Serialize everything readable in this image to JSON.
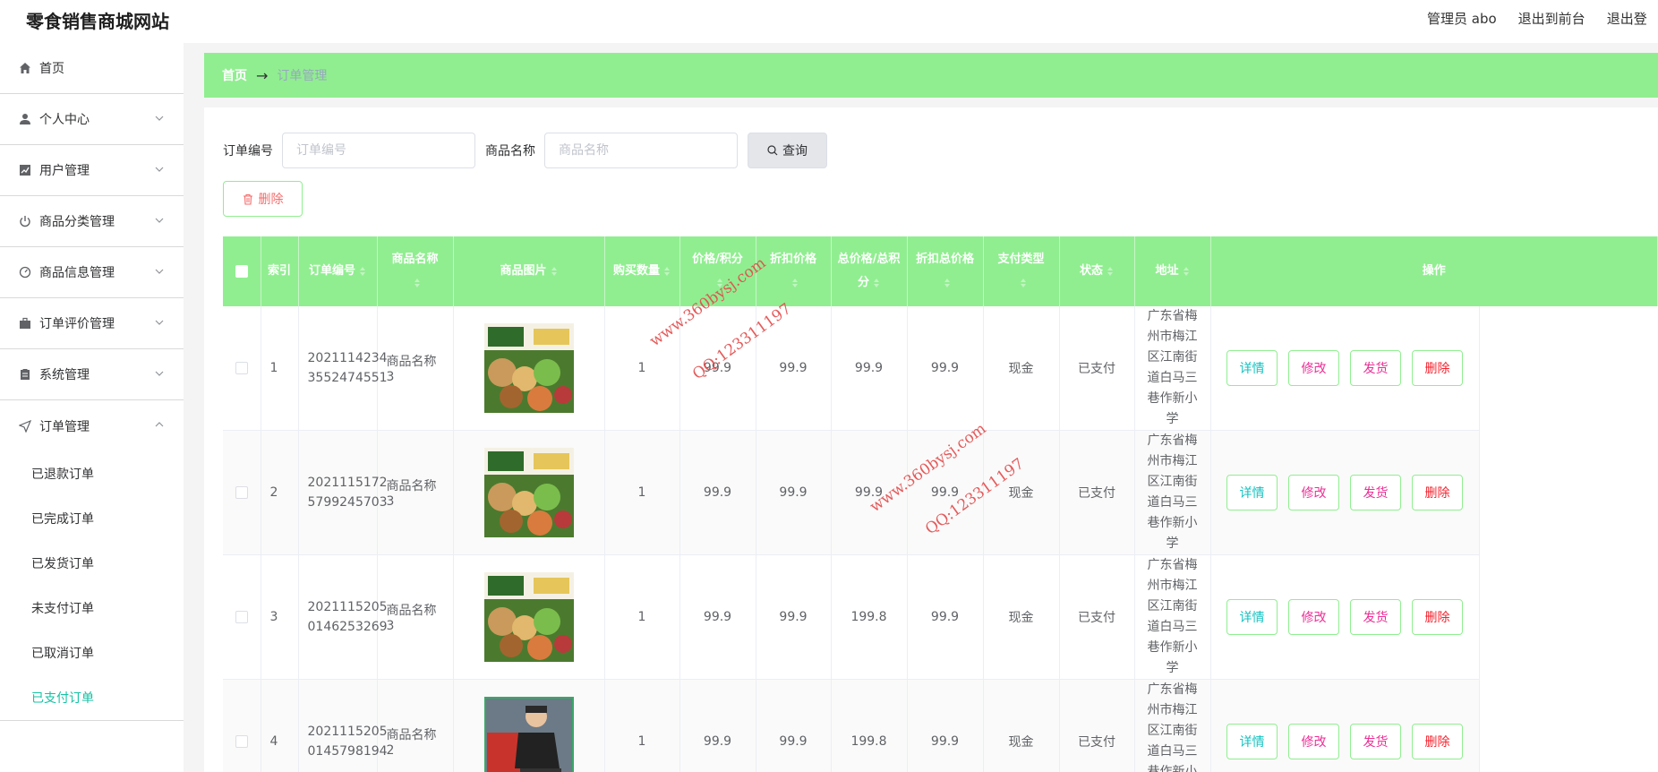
{
  "header": {
    "site_title": "零食销售商城网站",
    "admin_label": "管理员 abo",
    "back_to_front": "退出到前台",
    "logout": "退出登"
  },
  "sidebar": {
    "items": [
      {
        "label": "首页",
        "icon": "home-icon"
      },
      {
        "label": "个人中心",
        "icon": "user-icon"
      },
      {
        "label": "用户管理",
        "icon": "chart-icon"
      },
      {
        "label": "商品分类管理",
        "icon": "power-icon"
      },
      {
        "label": "商品信息管理",
        "icon": "gauge-icon"
      },
      {
        "label": "订单评价管理",
        "icon": "briefcase-icon"
      },
      {
        "label": "系统管理",
        "icon": "clipboard-icon"
      },
      {
        "label": "订单管理",
        "icon": "send-icon"
      }
    ],
    "sub_items": [
      {
        "label": "已退款订单",
        "active": false
      },
      {
        "label": "已完成订单",
        "active": false
      },
      {
        "label": "已发货订单",
        "active": false
      },
      {
        "label": "未支付订单",
        "active": false
      },
      {
        "label": "已取消订单",
        "active": false
      },
      {
        "label": "已支付订单",
        "active": true
      }
    ]
  },
  "breadcrumb": {
    "home": "首页",
    "arrow": "→",
    "current": "订单管理"
  },
  "search": {
    "order_no_label": "订单编号",
    "order_no_placeholder": "订单编号",
    "product_name_label": "商品名称",
    "product_name_placeholder": "商品名称",
    "search_button": "查询"
  },
  "toolbar": {
    "delete_button": "删除"
  },
  "table": {
    "headers": [
      "索引",
      "订单编号",
      "商品名称",
      "商品图片",
      "购买数量",
      "价格/积分",
      "折扣价格",
      "总价格/总积分",
      "折扣总价格",
      "支付类型",
      "状态",
      "地址",
      "操作"
    ],
    "rows": [
      {
        "index": "1",
        "order_no": "20211142343552474551",
        "order_no_l1": "2021114234",
        "order_no_l2": "3552474551",
        "product": "商品名称3",
        "qty": "1",
        "price": "99.9",
        "discount_price": "99.9",
        "total": "99.9",
        "discount_total": "99.9",
        "pay_type": "现金",
        "status": "已支付",
        "address": "广东省梅州市梅江区江南街道白马三巷作新小学",
        "image": "snack-box"
      },
      {
        "index": "2",
        "order_no": "20211151725799245703",
        "order_no_l1": "2021115172",
        "order_no_l2": "5799245703",
        "product": "商品名称3",
        "qty": "1",
        "price": "99.9",
        "discount_price": "99.9",
        "total": "99.9",
        "discount_total": "99.9",
        "pay_type": "现金",
        "status": "已支付",
        "address": "广东省梅州市梅江区江南街道白马三巷作新小学",
        "image": "snack-box"
      },
      {
        "index": "3",
        "order_no": "20211152050146253269",
        "order_no_l1": "2021115205",
        "order_no_l2": "0146253269",
        "product": "商品名称3",
        "qty": "1",
        "price": "99.9",
        "discount_price": "99.9",
        "total": "199.8",
        "discount_total": "99.9",
        "pay_type": "现金",
        "status": "已支付",
        "address": "广东省梅州市梅江区江南街道白马三巷作新小学",
        "image": "snack-box"
      },
      {
        "index": "4",
        "order_no": "20211152050145798194",
        "order_no_l1": "2021115205",
        "order_no_l2": "0145798194",
        "product": "商品名称2",
        "qty": "1",
        "price": "99.9",
        "discount_price": "99.9",
        "total": "199.8",
        "discount_total": "99.9",
        "pay_type": "现金",
        "status": "已支付",
        "address": "广东省梅州市梅江区江南街道白马三巷作新小学",
        "image": "person-photo"
      }
    ],
    "actions": {
      "detail": "详情",
      "edit": "修改",
      "ship": "发货",
      "delete": "删除"
    }
  },
  "watermark": {
    "site": "www.360bysj.com",
    "qq": "QQ:123311197"
  },
  "colors": {
    "accent_green": "#90ee90",
    "active_teal": "#13c2a3",
    "danger": "#f56c6c"
  }
}
